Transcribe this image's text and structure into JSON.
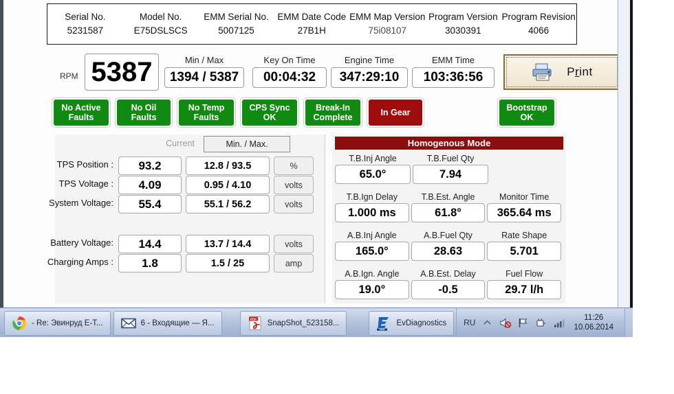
{
  "info_table": {
    "columns": [
      {
        "header": "Serial No.",
        "value": "5231587",
        "faint": false
      },
      {
        "header": "Model No.",
        "value": "E75DSLSCS",
        "faint": false
      },
      {
        "header": "EMM Serial No.",
        "value": "5007125",
        "faint": false
      },
      {
        "header": "EMM Date Code",
        "value": "27B1H",
        "faint": false
      },
      {
        "header": "EMM Map Version",
        "value": "75i08107",
        "faint": true
      },
      {
        "header": "Program Version",
        "value": "3030391",
        "faint": false
      },
      {
        "header": "Program Revision",
        "value": "4066",
        "faint": false
      }
    ]
  },
  "rpm_panel": {
    "rpm_label": "RPM",
    "rpm_value": "5387",
    "meters": [
      {
        "caption": "Min / Max",
        "value": "1394 / 5387"
      },
      {
        "caption": "Key On Time",
        "value": "00:04:32"
      },
      {
        "caption": "Engine Time",
        "value": "347:29:10"
      },
      {
        "caption": "EMM Time",
        "value": "103:36:56"
      }
    ],
    "print_button": {
      "label_pre": "P",
      "label_hot": "r",
      "label_post": "int",
      "icon": "printer-icon"
    }
  },
  "status_buttons": [
    {
      "label": "No Active\nFaults",
      "state": "ok",
      "color": "#108a10"
    },
    {
      "label": "No Oil\nFaults",
      "state": "ok",
      "color": "#108a10"
    },
    {
      "label": "No Temp\nFaults",
      "state": "ok",
      "color": "#108a10"
    },
    {
      "label": "CPS Sync\nOK",
      "state": "ok",
      "color": "#108a10"
    },
    {
      "label": "Break-In\nComplete",
      "state": "ok",
      "color": "#108a10"
    },
    {
      "label": "In Gear",
      "state": "alert",
      "color": "#9e0d0d"
    },
    {
      "label": "Bootstrap\nOK",
      "state": "ok",
      "color": "#108a10"
    }
  ],
  "left_panel": {
    "col_current": "Current",
    "btn_minmax": "Min. / Max.",
    "rows": [
      {
        "label": "TPS Position :",
        "current": "93.2",
        "minmax": "12.8 / 93.5",
        "unit": "%"
      },
      {
        "label": "TPS Voltage :",
        "current": "4.09",
        "minmax": "0.95 / 4.10",
        "unit": "volts"
      },
      {
        "label": "System Voltage:",
        "current": "55.4",
        "minmax": "55.1 / 56.2",
        "unit": "volts"
      },
      {
        "label": "Battery Voltage:",
        "current": "14.4",
        "minmax": "13.7 / 14.4",
        "unit": "volts"
      },
      {
        "label": "Charging Amps :",
        "current": "1.8",
        "minmax": "1.5 / 25",
        "unit": "amp"
      }
    ]
  },
  "right_panel": {
    "mode_title": "Homogenous Mode",
    "mode_title_color": "#8c0d0d",
    "grid": [
      [
        {
          "caption": "T.B.Inj Angle",
          "value": "65.0°"
        },
        {
          "caption": "T.B.Fuel Qty",
          "value": "7.94"
        }
      ],
      [
        {
          "caption": "T.B.Ign Delay",
          "value": "1.000 ms"
        },
        {
          "caption": "T.B.Est. Angle",
          "value": "61.8°"
        },
        {
          "caption": "Monitor Time",
          "value": "365.64 ms"
        }
      ],
      [
        {
          "caption": "A.B.Inj Angle",
          "value": "165.0°"
        },
        {
          "caption": "A.B.Fuel Qty",
          "value": "28.63"
        },
        {
          "caption": "Rate Shape",
          "value": "5.701"
        }
      ],
      [
        {
          "caption": "A.B.Ign. Angle",
          "value": "19.0°"
        },
        {
          "caption": "A.B.Est. Delay",
          "value": "-0.5"
        },
        {
          "caption": "Fuel Flow",
          "value": "29.7 l/h"
        }
      ]
    ]
  },
  "taskbar": {
    "items": [
      {
        "icon": "chrome-icon",
        "text": "- Re: Эвинруд E-T..."
      },
      {
        "icon": "mail-icon",
        "text": "6 - Входящие — Я..."
      },
      {
        "icon": "pdf-icon",
        "text": "SnapShot_523158..."
      },
      {
        "icon": "evdiag-icon",
        "text": "EvDiagnostics"
      }
    ],
    "tray": {
      "language": "RU",
      "icons": [
        "chevron-up-icon",
        "volume-muted-icon",
        "flag-icon",
        "network-plug-icon",
        "signal-bars-icon"
      ],
      "time": "11:26",
      "date": "10.06.2014"
    }
  },
  "scrollbar": {
    "up": "▲",
    "down": "▼"
  }
}
